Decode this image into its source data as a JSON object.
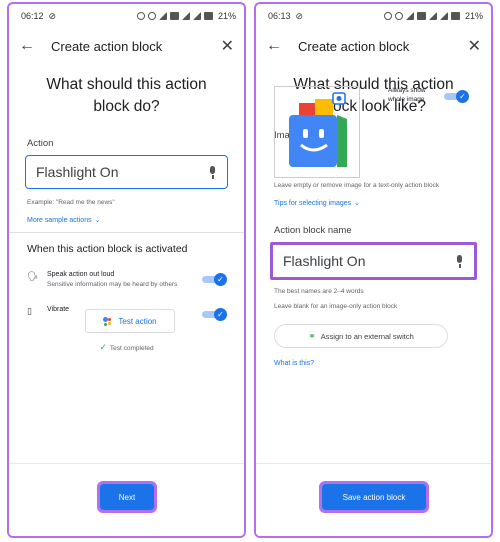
{
  "left": {
    "status": {
      "time": "06:12",
      "battery": "21%"
    },
    "toolbar": {
      "title": "Create action block"
    },
    "headline": "What should this action block do?",
    "action_label": "Action",
    "action_value": "Flashlight On",
    "example": "Example: \"Read me the news\"",
    "more_link": "More sample actions",
    "activated_title": "When this action block is activated",
    "speak_label": "Speak action out loud",
    "speak_sub": "Sensitive information may be heard by others",
    "vibrate_label": "Vibrate",
    "test_label": "Test action",
    "completed": "Test completed",
    "next_label": "Next"
  },
  "right": {
    "status": {
      "time": "06:13",
      "battery": "21%"
    },
    "toolbar": {
      "title": "Create action block"
    },
    "headline": "What should this action block look like?",
    "image_label": "Image",
    "always_show": "Always show whole image",
    "leave_empty": "Leave empty or remove image for a text-only action block",
    "tips_link": "Tips for selecting images",
    "name_label": "Action block name",
    "name_value": "Flashlight On",
    "best_names": "The best names are 2–4 words",
    "leave_blank": "Leave blank for an image-only action block",
    "assign_label": "Assign to an external switch",
    "what_is_this": "What is this?",
    "save_label": "Save action block"
  },
  "colors": {
    "accent": "#1a73e8",
    "highlight": "#b46ef0",
    "toggle_track": "#a8c7fa"
  }
}
